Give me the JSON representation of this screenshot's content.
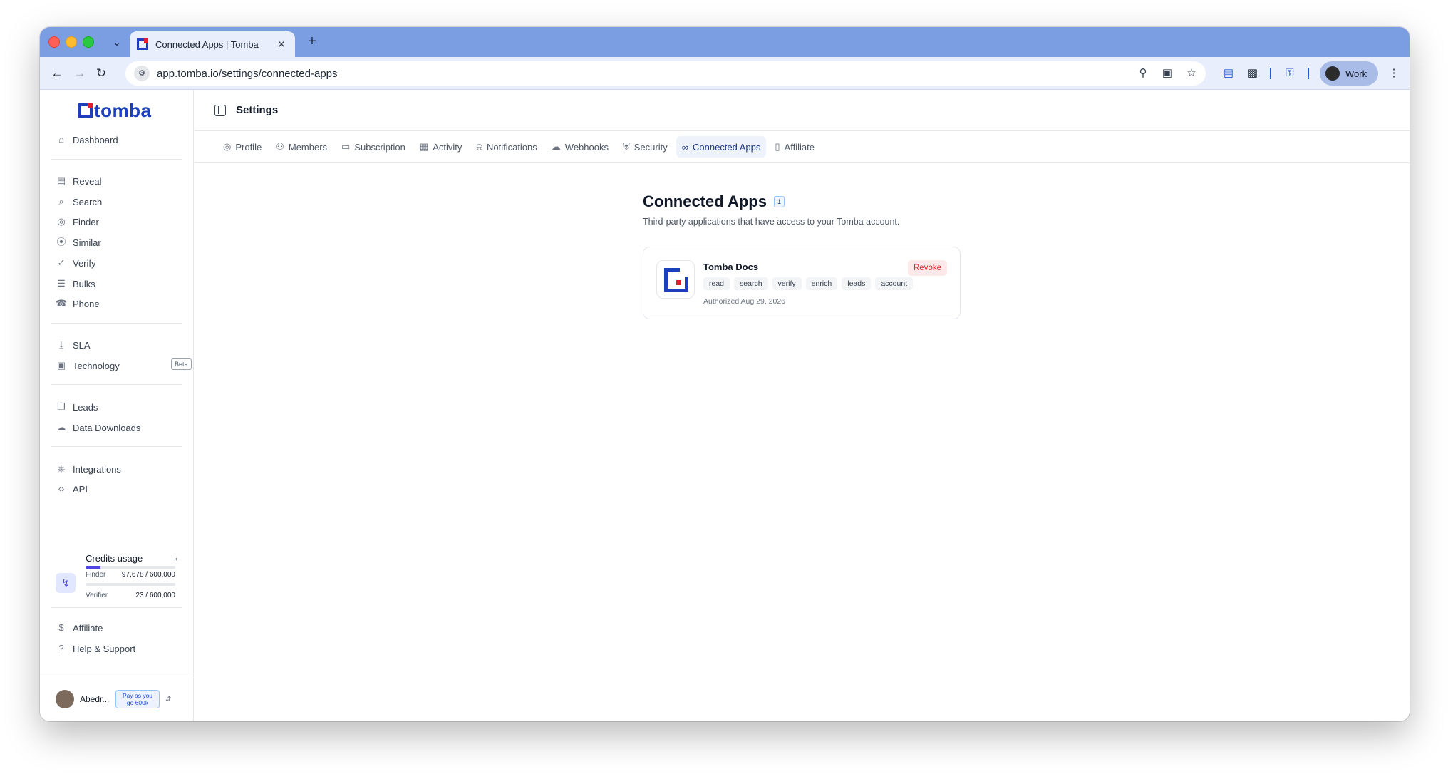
{
  "browser": {
    "tab_title": "Connected Apps | Tomba",
    "url": "app.tomba.io/settings/connected-apps",
    "profile_label": "Work"
  },
  "sidebar": {
    "logo_text": "tomba",
    "groups": [
      [
        {
          "label": "Dashboard",
          "icon": "home-icon"
        }
      ],
      [
        {
          "label": "Reveal",
          "icon": "building-icon"
        },
        {
          "label": "Search",
          "icon": "search-icon"
        },
        {
          "label": "Finder",
          "icon": "user-circle-icon"
        },
        {
          "label": "Similar",
          "icon": "fingerprint-icon"
        },
        {
          "label": "Verify",
          "icon": "check-circle-icon"
        },
        {
          "label": "Bulks",
          "icon": "list-icon"
        },
        {
          "label": "Phone",
          "icon": "phone-icon"
        }
      ],
      [
        {
          "label": "SLA",
          "icon": "download-icon"
        },
        {
          "label": "Technology",
          "icon": "chip-icon",
          "badge": "Beta"
        }
      ],
      [
        {
          "label": "Leads",
          "icon": "file-plus-icon"
        },
        {
          "label": "Data Downloads",
          "icon": "cloud-icon"
        }
      ],
      [
        {
          "label": "Integrations",
          "icon": "plug-icon"
        },
        {
          "label": "API",
          "icon": "code-icon"
        }
      ]
    ],
    "credits": {
      "title": "Credits usage",
      "finder_label": "Finder",
      "finder_value": "97,678 / 600,000",
      "finder_fraction": 0.163,
      "verifier_label": "Verifier",
      "verifier_value": "23 / 600,000",
      "verifier_fraction": 4e-05
    },
    "footer_items": [
      {
        "label": "Affiliate",
        "icon": "dollar-circle-icon"
      },
      {
        "label": "Help & Support",
        "icon": "help-circle-icon"
      }
    ],
    "user": {
      "name": "Abedr...",
      "plan_line1": "Pay as you",
      "plan_line2": "go 600k"
    }
  },
  "header": {
    "title": "Settings"
  },
  "settings_tabs": [
    {
      "label": "Profile",
      "icon": "user-circle-icon",
      "active": false
    },
    {
      "label": "Members",
      "icon": "users-icon",
      "active": false
    },
    {
      "label": "Subscription",
      "icon": "card-icon",
      "active": false
    },
    {
      "label": "Activity",
      "icon": "table-icon",
      "active": false
    },
    {
      "label": "Notifications",
      "icon": "bell-icon",
      "active": false
    },
    {
      "label": "Webhooks",
      "icon": "cloud-upload-icon",
      "active": false
    },
    {
      "label": "Security",
      "icon": "shield-icon",
      "active": false
    },
    {
      "label": "Connected Apps",
      "icon": "link-icon",
      "active": true
    },
    {
      "label": "Affiliate",
      "icon": "book-icon",
      "active": false
    }
  ],
  "main": {
    "title": "Connected Apps",
    "count": "1",
    "subtitle": "Third-party applications that have access to your Tomba account.",
    "apps": [
      {
        "name": "Tomba Docs",
        "scopes": [
          "read",
          "search",
          "verify",
          "enrich",
          "leads",
          "account"
        ],
        "authorized": "Authorized Aug 29, 2026",
        "action": "Revoke"
      }
    ]
  },
  "chat": {
    "badge_count": "1"
  },
  "colors": {
    "brand": "#1d3fbd",
    "accent_red": "#e11d2e",
    "active_tab_bg": "#eef2fb",
    "revoke_text": "#dc2626"
  }
}
